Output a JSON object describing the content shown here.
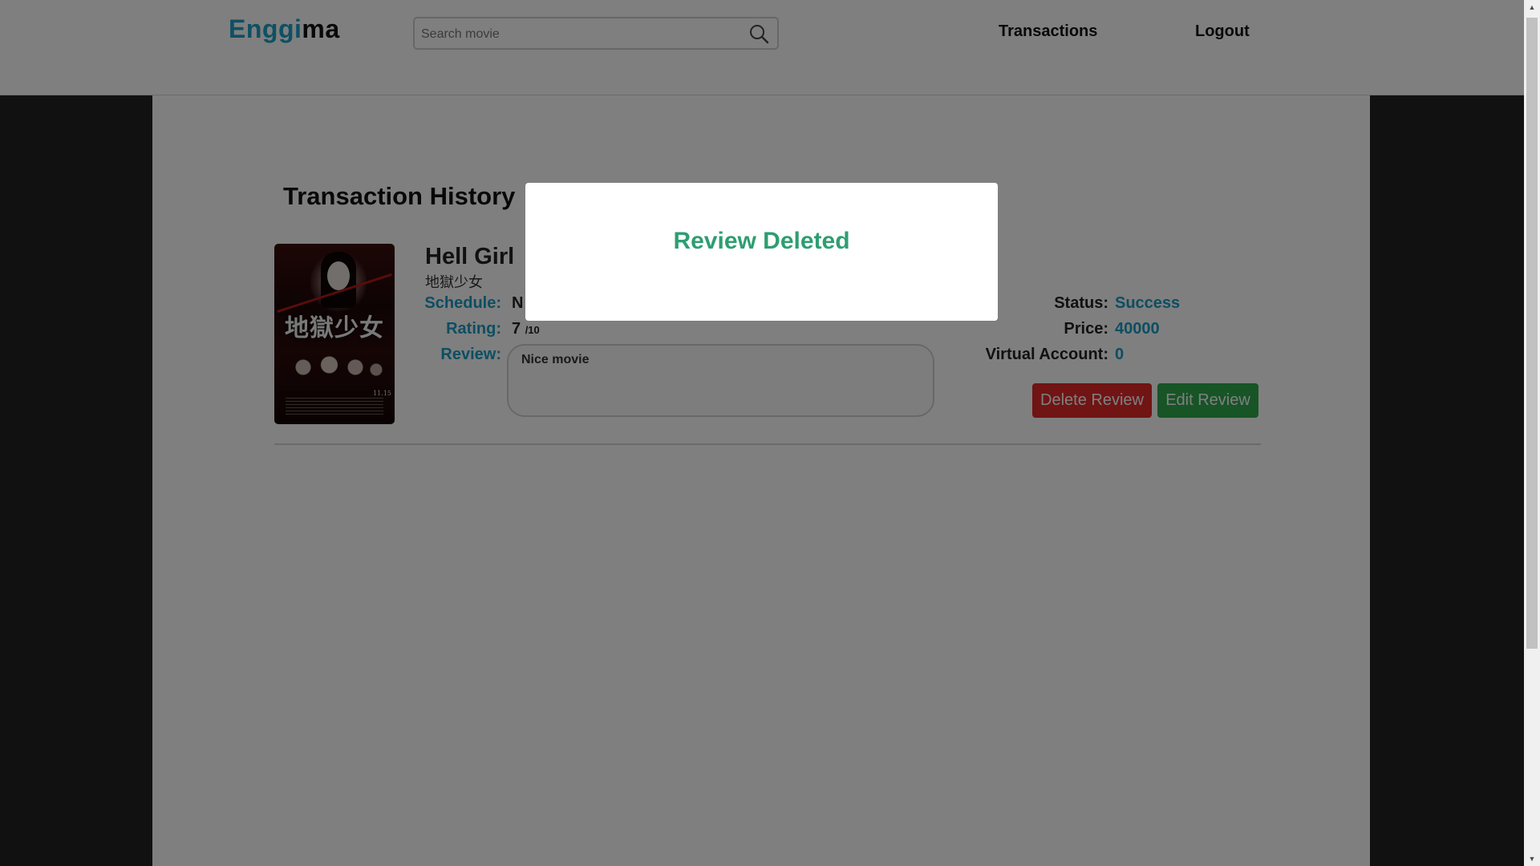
{
  "header": {
    "logo": {
      "part1": "Eng",
      "part2": "i",
      "part3": "gi",
      "part4": "ma"
    },
    "search": {
      "placeholder": "Search movie",
      "value": ""
    },
    "nav": {
      "transactions": "Transactions",
      "logout": "Logout"
    }
  },
  "page": {
    "title": "Transaction History"
  },
  "transaction": {
    "movie_title": "Hell Girl",
    "movie_subtitle": "地獄少女",
    "poster": {
      "title_text": "地獄少女",
      "date_text": "11.15"
    },
    "labels": {
      "schedule": "Schedule:",
      "rating": "Rating:",
      "review": "Review:",
      "status": "Status:",
      "price": "Price:",
      "virtual_account": "Virtual Account:"
    },
    "schedule_visible_text": "N",
    "rating_value": "7",
    "rating_scale": "/10",
    "review_text": "Nice movie",
    "status": "Success",
    "price": "40000",
    "virtual_account": "0",
    "buttons": {
      "delete": "Delete Review",
      "edit": "Edit Review"
    }
  },
  "modal": {
    "title": "Review Deleted"
  },
  "colors": {
    "accent": "#1a9cc4",
    "delete_button": "#e12828",
    "edit_button": "#2ea84d",
    "modal_title": "#2e9e72",
    "page_background": "#222222"
  },
  "icons": {
    "search": "search-icon"
  }
}
